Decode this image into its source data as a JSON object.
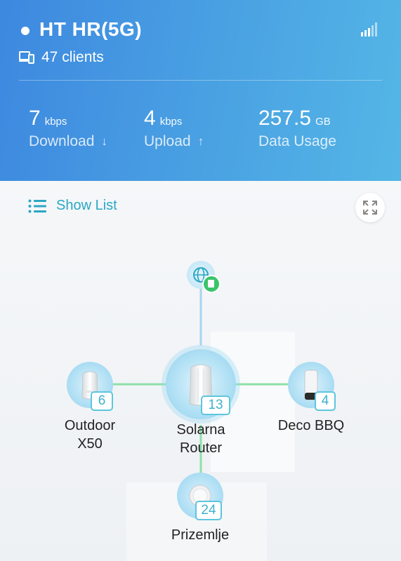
{
  "header": {
    "network_name": "HT HR(5G)",
    "clients": "47 clients",
    "download": {
      "value": "7",
      "unit": "kbps",
      "label": "Download",
      "arrow": "↓"
    },
    "upload": {
      "value": "4",
      "unit": "kbps",
      "label": "Upload",
      "arrow": "↑"
    },
    "usage": {
      "value": "257.5",
      "unit": "GB",
      "label": "Data Usage"
    }
  },
  "toolbar": {
    "show_list": "Show List"
  },
  "topology": {
    "nodes": [
      {
        "id": "main",
        "name_line1": "Solarna",
        "name_line2": "Router",
        "clients": "13"
      },
      {
        "id": "left",
        "name_line1": "Outdoor",
        "name_line2": "X50",
        "clients": "6"
      },
      {
        "id": "right",
        "name_line1": "Deco BBQ",
        "name_line2": "",
        "clients": "4"
      },
      {
        "id": "bottom",
        "name_line1": "Prizemlje",
        "name_line2": "",
        "clients": "24"
      }
    ]
  },
  "colors": {
    "header_start": "#3d88e0",
    "header_end": "#54b6e6",
    "accent": "#2aa7c4",
    "link_line": "#8ee0a9",
    "uplink_line": "#a9d3ee"
  }
}
